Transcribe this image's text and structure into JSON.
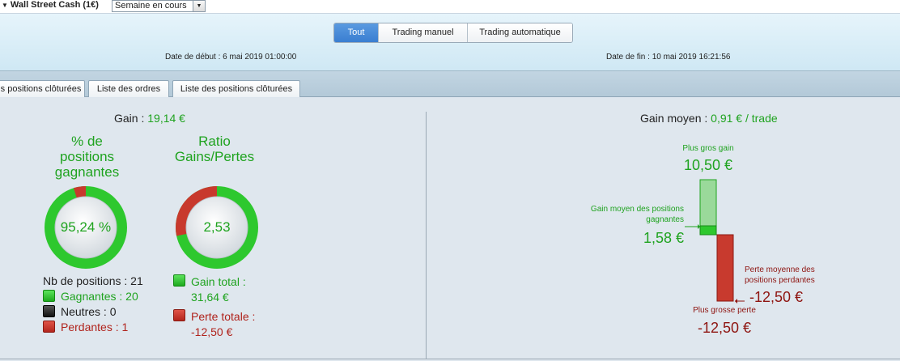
{
  "topbar": {
    "account": "Wall Street Cash (1€)",
    "period_select": "Semaine en cours"
  },
  "header": {
    "segments": [
      "Tout",
      "Trading manuel",
      "Trading automatique"
    ],
    "active_segment": "Tout",
    "start_date": "Date de début :  6 mai 2019 01:00:00",
    "end_date": "Date de fin :  10 mai 2019 16:21:56"
  },
  "tabs": [
    "s positions clôturées",
    "Liste des ordres",
    "Liste des positions clôturées"
  ],
  "left": {
    "gain_label": "Gain :",
    "gain_value": "19,14 €",
    "pct_title": [
      "% de",
      "positions",
      "gagnantes"
    ],
    "pct_value": "95,24 %",
    "pct_fraction": 0.9524,
    "ratio_title": [
      "Ratio",
      "Gains/Pertes"
    ],
    "ratio_value": "2,53",
    "ratio_fraction": 0.7168,
    "nb_positions": "Nb de positions : 21",
    "gagnantes": "Gagnantes : 20",
    "neutres": "Neutres : 0",
    "perdantes": "Perdantes : 1",
    "gain_total_label": "Gain total :",
    "gain_total_value": "31,64 €",
    "perte_totale_label": "Perte totale :",
    "perte_totale_value": "-12,50 €"
  },
  "right": {
    "gain_moyen_label": "Gain moyen :",
    "gain_moyen_value": "0,91 € / trade",
    "plus_gros_gain_label": "Plus gros gain",
    "plus_gros_gain_value": "10,50 €",
    "gain_moyen_pos_label": [
      "Gain moyen des positions",
      "gagnantes"
    ],
    "gain_moyen_pos_value": "1,58 €",
    "perte_moyenne_label": [
      "Perte moyenne des",
      "positions perdantes"
    ],
    "perte_moyenne_value": "-12,50 €",
    "plus_grosse_perte_label": "Plus grosse perte",
    "plus_grosse_perte_value": "-12,50 €"
  },
  "colors": {
    "green": "#1fa31f",
    "red": "#c0342a",
    "accent_blue": "#3a7ed1"
  }
}
